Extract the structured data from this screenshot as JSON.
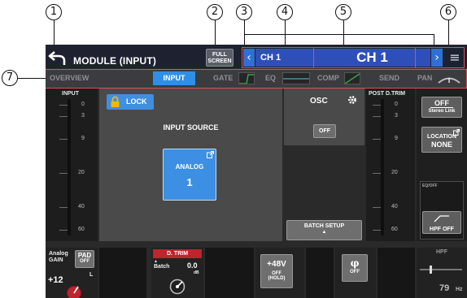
{
  "callouts": [
    "1",
    "2",
    "3",
    "4",
    "5",
    "6",
    "7"
  ],
  "titlebar": {
    "title": "MODULE (INPUT)",
    "full_screen_line1": "FULL",
    "full_screen_line2": "SCREEN",
    "prev_symbol": "‹",
    "next_symbol": "›",
    "channel_name": "CH 1",
    "channel_display": "CH 1",
    "menu_symbol": "≡"
  },
  "tabs": [
    {
      "label": "OVERVIEW",
      "active": false
    },
    {
      "label": "INPUT",
      "active": true
    },
    {
      "label": "GATE",
      "active": false
    },
    {
      "label": "EQ",
      "active": false
    },
    {
      "label": "COMP",
      "active": false
    },
    {
      "label": "SEND",
      "active": false
    },
    {
      "label": "PAN",
      "active": false
    }
  ],
  "meters": {
    "input_label": "INPUT",
    "post_label": "POST D.TRIM",
    "scale": [
      "0",
      "3",
      "9",
      "20",
      "40",
      "60"
    ]
  },
  "center": {
    "lock_label": "LOCK",
    "input_source_label": "INPUT SOURCE",
    "source_type": "ANALOG",
    "source_number": "1"
  },
  "osc": {
    "label": "OSC",
    "button": "OFF"
  },
  "batch_setup": {
    "label": "BATCH SETUP",
    "arrow": "▲"
  },
  "right": {
    "stereo_state": "OFF",
    "stereo_label": "Stereo Link",
    "location_label": "LOCATION",
    "location_value": "NONE",
    "eq_label": "EQ/OFF",
    "hpf_label": "HPF OFF"
  },
  "bottom": {
    "analog_gain_line1": "Analog",
    "analog_gain_line2": "GAIN",
    "pad_label": "PAD",
    "pad_value": "OFF",
    "gain_value": "+12",
    "gain_side": "L",
    "dtrim_label": "D. TRIM",
    "batch_label": "Batch",
    "dtrim_value": "0.0",
    "dtrim_unit": "dB",
    "phantom_label": "+48V",
    "phantom_state": "OFF",
    "phantom_hold": "(HOLD)",
    "phase_symbol": "φ",
    "phase_state": "OFF",
    "hpf_title": "HPF",
    "hpf_value": "79",
    "hpf_unit": "Hz"
  },
  "colors": {
    "accent_blue": "#2f8fe6",
    "title_blue": "#2f4fb8",
    "highlight_red": "#e64a55",
    "dtrim_red": "#c0242c"
  }
}
